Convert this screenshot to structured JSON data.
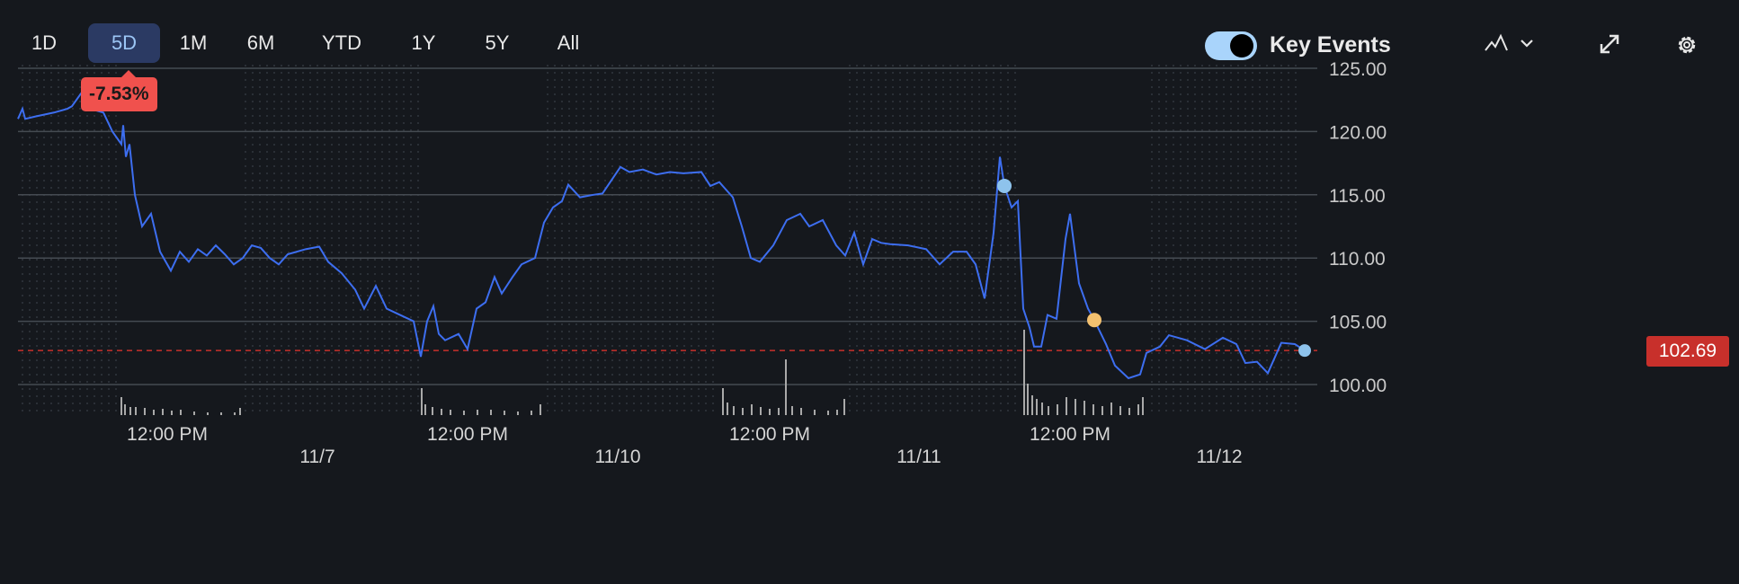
{
  "ranges": [
    "1D",
    "5D",
    "1M",
    "6M",
    "YTD",
    "1Y",
    "5Y",
    "All"
  ],
  "active_range": "5D",
  "change_badge": "-7.53%",
  "key_events_label": "Key Events",
  "key_events_on": true,
  "current_price_label": "102.69",
  "colors": {
    "line": "#3d6ef0",
    "accent": "#9cc6f5",
    "negative": "#f0514d",
    "price_tag": "#c8302b",
    "event_blue": "#8ec3ec",
    "event_yellow": "#f2c06f"
  },
  "chart_data": {
    "type": "line",
    "ylim": [
      98.5,
      126
    ],
    "xlim": [
      0,
      1435
    ],
    "y_ticks": [
      "125.00",
      "120.00",
      "115.00",
      "110.00",
      "105.00",
      "100.00"
    ],
    "y_tick_values": [
      125,
      120,
      115,
      110,
      105,
      100
    ],
    "x_time_labels": [
      {
        "t": 166,
        "label": "12:00 PM"
      },
      {
        "t": 500,
        "label": "12:00 PM"
      },
      {
        "t": 836,
        "label": "12:00 PM"
      },
      {
        "t": 1170,
        "label": "12:00 PM"
      }
    ],
    "x_date_labels": [
      {
        "t": 333,
        "label": "11/7"
      },
      {
        "t": 667,
        "label": "11/10"
      },
      {
        "t": 1002,
        "label": "11/11"
      },
      {
        "t": 1336,
        "label": "11/12"
      }
    ],
    "extended_hours": [
      [
        0,
        110
      ],
      [
        250,
        448
      ],
      [
        588,
        780
      ],
      [
        920,
        1115
      ],
      [
        1255,
        1425
      ]
    ],
    "reference_line": 102.69,
    "series": [
      {
        "name": "Price",
        "points": [
          [
            0,
            121
          ],
          [
            5,
            121.8
          ],
          [
            8,
            121
          ],
          [
            20,
            121.2
          ],
          [
            40,
            121.5
          ],
          [
            55,
            121.8
          ],
          [
            60,
            122
          ],
          [
            70,
            123
          ],
          [
            80,
            121.8
          ],
          [
            95,
            121.5
          ],
          [
            105,
            120
          ],
          [
            115,
            119
          ],
          [
            117,
            120.5
          ],
          [
            120,
            118
          ],
          [
            124,
            119
          ],
          [
            130,
            115
          ],
          [
            138,
            112.5
          ],
          [
            148,
            113.5
          ],
          [
            158,
            110.5
          ],
          [
            170,
            109
          ],
          [
            180,
            110.5
          ],
          [
            190,
            109.7
          ],
          [
            200,
            110.7
          ],
          [
            210,
            110.2
          ],
          [
            220,
            111
          ],
          [
            230,
            110.3
          ],
          [
            240,
            109.5
          ],
          [
            250,
            110
          ],
          [
            260,
            111
          ],
          [
            270,
            110.8
          ],
          [
            280,
            110
          ],
          [
            290,
            109.5
          ],
          [
            300,
            110.3
          ],
          [
            320,
            110.7
          ],
          [
            335,
            110.9
          ],
          [
            345,
            109.7
          ],
          [
            360,
            108.8
          ],
          [
            375,
            107.5
          ],
          [
            385,
            106
          ],
          [
            398,
            107.8
          ],
          [
            410,
            106
          ],
          [
            425,
            105.5
          ],
          [
            440,
            105
          ],
          [
            448,
            102.2
          ],
          [
            455,
            105
          ],
          [
            462,
            106.2
          ],
          [
            468,
            104
          ],
          [
            475,
            103.5
          ],
          [
            490,
            104
          ],
          [
            500,
            102.8
          ],
          [
            510,
            106
          ],
          [
            520,
            106.5
          ],
          [
            530,
            108.5
          ],
          [
            538,
            107.2
          ],
          [
            550,
            108.5
          ],
          [
            560,
            109.5
          ],
          [
            575,
            110
          ],
          [
            585,
            112.8
          ],
          [
            595,
            114
          ],
          [
            605,
            114.5
          ],
          [
            612,
            115.8
          ],
          [
            625,
            114.8
          ],
          [
            640,
            115
          ],
          [
            650,
            115.1
          ],
          [
            670,
            117.2
          ],
          [
            680,
            116.8
          ],
          [
            695,
            117
          ],
          [
            710,
            116.6
          ],
          [
            725,
            116.8
          ],
          [
            740,
            116.7
          ],
          [
            760,
            116.8
          ],
          [
            770,
            115.7
          ],
          [
            780,
            116
          ],
          [
            785,
            115.6
          ],
          [
            795,
            114.8
          ],
          [
            805,
            112.5
          ],
          [
            815,
            110
          ],
          [
            825,
            109.7
          ],
          [
            840,
            111
          ],
          [
            855,
            113
          ],
          [
            870,
            113.5
          ],
          [
            880,
            112.5
          ],
          [
            895,
            113
          ],
          [
            910,
            111
          ],
          [
            920,
            110.2
          ],
          [
            930,
            112
          ],
          [
            940,
            109.5
          ],
          [
            950,
            111.5
          ],
          [
            960,
            111.2
          ],
          [
            970,
            111.1
          ],
          [
            990,
            111
          ],
          [
            1010,
            110.7
          ],
          [
            1025,
            109.5
          ],
          [
            1040,
            110.5
          ],
          [
            1055,
            110.5
          ],
          [
            1065,
            109.5
          ],
          [
            1075,
            106.8
          ],
          [
            1085,
            112
          ],
          [
            1092,
            118
          ],
          [
            1097,
            115.7
          ],
          [
            1105,
            114
          ],
          [
            1112,
            114.5
          ],
          [
            1118,
            106
          ],
          [
            1125,
            104.5
          ],
          [
            1130,
            103
          ],
          [
            1138,
            103
          ],
          [
            1145,
            105.5
          ],
          [
            1155,
            105.2
          ],
          [
            1165,
            111.5
          ],
          [
            1170,
            113.5
          ],
          [
            1180,
            108
          ],
          [
            1190,
            106
          ],
          [
            1197,
            105.1
          ],
          [
            1210,
            103.2
          ],
          [
            1220,
            101.5
          ],
          [
            1235,
            100.5
          ],
          [
            1248,
            100.8
          ],
          [
            1255,
            102.5
          ],
          [
            1270,
            103
          ],
          [
            1280,
            103.9
          ],
          [
            1300,
            103.5
          ],
          [
            1320,
            102.8
          ],
          [
            1340,
            103.7
          ],
          [
            1355,
            103.2
          ],
          [
            1365,
            101.7
          ],
          [
            1378,
            101.8
          ],
          [
            1390,
            100.9
          ],
          [
            1405,
            103.3
          ],
          [
            1420,
            103.2
          ],
          [
            1431,
            102.69
          ]
        ]
      }
    ],
    "volume": [
      [
        114,
        20
      ],
      [
        118,
        12
      ],
      [
        124,
        9
      ],
      [
        130,
        9
      ],
      [
        140,
        8
      ],
      [
        150,
        6
      ],
      [
        160,
        7
      ],
      [
        170,
        5
      ],
      [
        180,
        6
      ],
      [
        195,
        4
      ],
      [
        210,
        3
      ],
      [
        225,
        3
      ],
      [
        240,
        3
      ],
      [
        246,
        8
      ],
      [
        448,
        30
      ],
      [
        452,
        12
      ],
      [
        460,
        9
      ],
      [
        470,
        7
      ],
      [
        480,
        6
      ],
      [
        495,
        5
      ],
      [
        510,
        6
      ],
      [
        525,
        6
      ],
      [
        540,
        5
      ],
      [
        555,
        4
      ],
      [
        570,
        5
      ],
      [
        580,
        12
      ],
      [
        783,
        30
      ],
      [
        788,
        14
      ],
      [
        795,
        10
      ],
      [
        805,
        8
      ],
      [
        815,
        12
      ],
      [
        825,
        9
      ],
      [
        835,
        7
      ],
      [
        845,
        8
      ],
      [
        853,
        62
      ],
      [
        860,
        10
      ],
      [
        870,
        8
      ],
      [
        885,
        6
      ],
      [
        900,
        5
      ],
      [
        910,
        6
      ],
      [
        918,
        18
      ],
      [
        1118,
        95
      ],
      [
        1122,
        35
      ],
      [
        1127,
        22
      ],
      [
        1132,
        18
      ],
      [
        1138,
        14
      ],
      [
        1145,
        10
      ],
      [
        1155,
        12
      ],
      [
        1165,
        20
      ],
      [
        1175,
        18
      ],
      [
        1185,
        16
      ],
      [
        1195,
        12
      ],
      [
        1205,
        10
      ],
      [
        1215,
        14
      ],
      [
        1225,
        10
      ],
      [
        1235,
        8
      ],
      [
        1245,
        12
      ],
      [
        1250,
        20
      ]
    ],
    "key_events": [
      {
        "t": 1097,
        "price": 115.7,
        "kind": "blue"
      },
      {
        "t": 1197,
        "price": 105.1,
        "kind": "yellow"
      }
    ]
  }
}
